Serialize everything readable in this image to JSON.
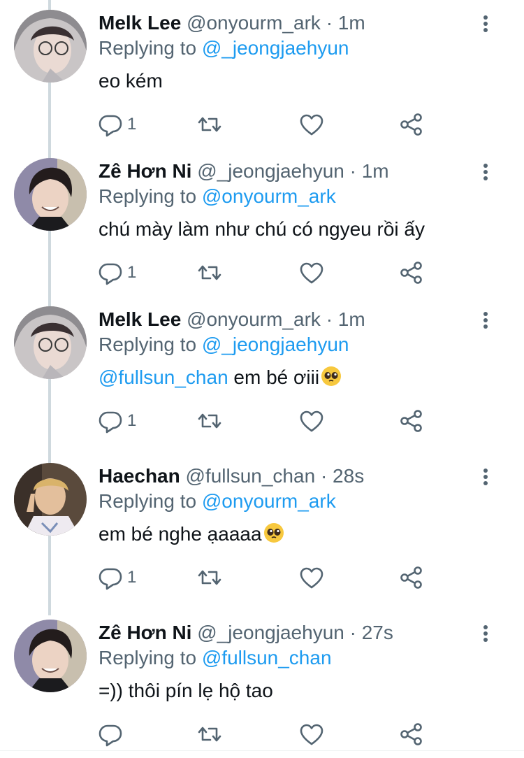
{
  "colors": {
    "accent": "#1d9bf0",
    "muted": "#536471",
    "text": "#0f1419",
    "thread_line": "#cfd9de"
  },
  "tweets": [
    {
      "name": "Melk Lee",
      "handle": "@onyourm_ark",
      "dot": "·",
      "time": "1m",
      "reply_prefix": "Replying to",
      "reply_to": "@_jeongjaehyun",
      "mention": "",
      "text": "eo kém",
      "emoji": "",
      "reply_count": "1",
      "avatar": "melk-avatar"
    },
    {
      "name": "Zê Hơn Ni",
      "handle": "@_jeongjaehyun",
      "dot": "·",
      "time": "1m",
      "reply_prefix": "Replying to",
      "reply_to": "@onyourm_ark",
      "mention": "",
      "text": "chú mày làm như chú có ngyeu rồi ấy",
      "emoji": "",
      "reply_count": "1",
      "avatar": "jaehyun-avatar"
    },
    {
      "name": "Melk Lee",
      "handle": "@onyourm_ark",
      "dot": "·",
      "time": "1m",
      "reply_prefix": "Replying to",
      "reply_to": "@_jeongjaehyun",
      "mention": "@fullsun_chan",
      "text": " em bé ơiii",
      "emoji": "pleading-face",
      "reply_count": "1",
      "avatar": "melk-avatar"
    },
    {
      "name": "Haechan",
      "handle": "@fullsun_chan",
      "dot": "·",
      "time": "28s",
      "reply_prefix": "Replying to",
      "reply_to": "@onyourm_ark",
      "mention": "",
      "text": "em bé nghe ạaaaa",
      "emoji": "pleading-face",
      "reply_count": "1",
      "avatar": "haechan-avatar"
    },
    {
      "name": "Zê Hơn Ni",
      "handle": "@_jeongjaehyun",
      "dot": "·",
      "time": "27s",
      "reply_prefix": "Replying to",
      "reply_to": "@fullsun_chan",
      "mention": "",
      "text": "=)) thôi pín lẹ hộ tao",
      "emoji": "",
      "reply_count": "",
      "avatar": "jaehyun-avatar"
    }
  ],
  "icons": {
    "reply": "reply-bubble-icon",
    "retweet": "retweet-icon",
    "like": "heart-icon",
    "share": "share-icon",
    "more": "more-vertical-icon"
  }
}
